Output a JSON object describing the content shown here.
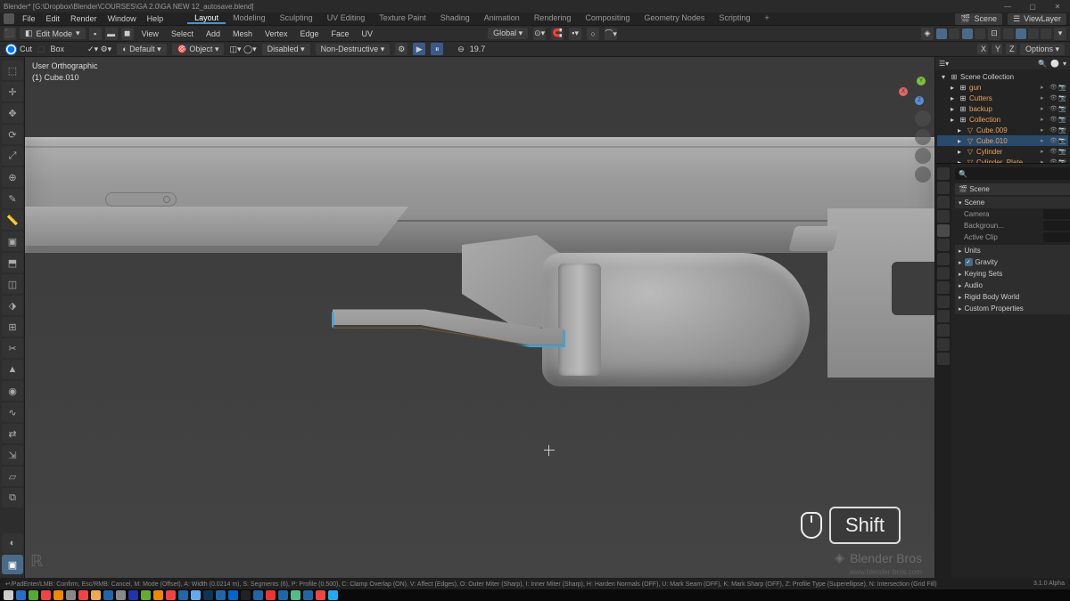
{
  "titlebar": {
    "path": "Blender* [G:\\Dropbox\\Blender\\COURSES\\GA 2.0\\GA NEW 12_autosave.blend]"
  },
  "menu": {
    "items": [
      "File",
      "Edit",
      "Render",
      "Window",
      "Help"
    ]
  },
  "workspaces": {
    "tabs": [
      "Layout",
      "Modeling",
      "Sculpting",
      "UV Editing",
      "Texture Paint",
      "Shading",
      "Animation",
      "Rendering",
      "Compositing",
      "Geometry Nodes",
      "Scripting"
    ],
    "active": "Layout",
    "plus": "+"
  },
  "scene": {
    "label": "Scene",
    "viewlayer": "ViewLayer"
  },
  "toolbar1": {
    "mode": "Edit Mode",
    "menu_items": [
      "View",
      "Select",
      "Add",
      "Mesh",
      "Vertex",
      "Edge",
      "Face",
      "UV"
    ],
    "orientation": "Global",
    "overlays_val": "19.7"
  },
  "toolbar2": {
    "cut": "Cut",
    "box": "Box",
    "default": "Default",
    "object": "Object",
    "disabled": "Disabled",
    "nondestructive": "Non-Destructive",
    "xyz": [
      "X",
      "Y",
      "Z"
    ],
    "options": "Options"
  },
  "viewport": {
    "view_label": "User Orthographic",
    "object_label": "(1) Cube.010",
    "key_hint": "Shift",
    "watermark": "Blender Bros",
    "watermark_url": "www.blender-bros.com"
  },
  "outliner": {
    "root": "Scene Collection",
    "items": [
      {
        "label": "gun",
        "indent": 1,
        "orange": true
      },
      {
        "label": "Cutters",
        "indent": 1,
        "orange": true
      },
      {
        "label": "backup",
        "indent": 1,
        "orange": true
      },
      {
        "label": "Collection",
        "indent": 1,
        "orange": true
      },
      {
        "label": "Cube.009",
        "indent": 2,
        "orange": true
      },
      {
        "label": "Cube.010",
        "indent": 2,
        "orange": true,
        "selected": true
      },
      {
        "label": "Cylinder",
        "indent": 2,
        "orange": true
      },
      {
        "label": "Cylinder_Plate",
        "indent": 2,
        "orange": true
      }
    ]
  },
  "properties": {
    "context": "Scene",
    "sections": {
      "scene": "Scene",
      "camera": "Camera",
      "background": "Backgroun...",
      "active_clip": "Active Clip",
      "units": "Units",
      "gravity": "Gravity",
      "keying": "Keying Sets",
      "audio": "Audio",
      "rigid": "Rigid Body World",
      "custom": "Custom Properties"
    }
  },
  "statusbar": {
    "hints": "↵/PadEnter/LMB: Confirm, Esc/RMB: Cancel, M: Mode (Offset), A: Width (0.0214 m), S: Segments (6), P: Profile (0.500), C: Clamp Overlap (ON), V: Affect (Edges), O: Outer Miter (Sharp), I: Inner Miter (Sharp), H: Harden Normals (OFF), U: Mark Seam (OFF), K: Mark Sharp (OFF), Z: Profile Type (Superellipse), N: Intersection (Grid Fill)",
    "version": "3.1.0 Alpha"
  },
  "taskbar_colors": [
    "#ccc",
    "#276ec4",
    "#5a3",
    "#e44",
    "#e80",
    "#888",
    "#e44",
    "#ea5",
    "#26a",
    "#888",
    "#23a",
    "#6a3",
    "#e80",
    "#e44",
    "#26a",
    "#6ae",
    "#135",
    "#26a",
    "#06c",
    "#222",
    "#26a",
    "#e33",
    "#26a",
    "#5b8",
    "#26a",
    "#e44",
    "#2ae"
  ]
}
